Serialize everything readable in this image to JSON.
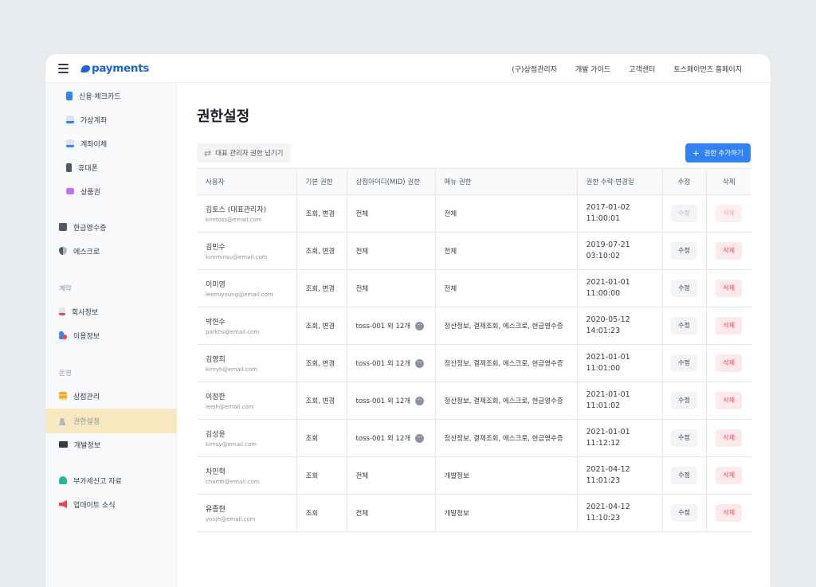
{
  "header": {
    "logo_text": "payments",
    "nav": [
      "(구)상점관리자",
      "개발 가이드",
      "고객센터",
      "토스페이먼츠 홈페이지"
    ]
  },
  "sidebar": {
    "items": [
      {
        "label": "신용·체크카드",
        "icon": "credit-card-icon",
        "color": "#3182f6"
      },
      {
        "label": "가상계좌",
        "icon": "virtual-account-icon",
        "color": "#3182f6"
      },
      {
        "label": "계좌이체",
        "icon": "bank-transfer-icon",
        "color": "#3182f6"
      },
      {
        "label": "휴대폰",
        "icon": "mobile-phone-icon",
        "color": "#4e5968"
      },
      {
        "label": "상품권",
        "icon": "gift-card-icon",
        "color": "#c770f0"
      },
      {
        "label": "현금영수증",
        "icon": "cash-receipt-icon",
        "color": "#4e5968"
      },
      {
        "label": "에스크로",
        "icon": "escrow-shield-icon",
        "color": "#4e5968"
      },
      {
        "label": "회사정보",
        "icon": "company-info-icon",
        "color": "#f04452"
      },
      {
        "label": "이용정보",
        "icon": "usage-info-icon",
        "color": "#3182f6"
      },
      {
        "label": "상점관리",
        "icon": "store-icon",
        "color": "#f5a623"
      },
      {
        "label": "권한설정",
        "icon": "user-add-icon",
        "color": "#b0b8c1"
      },
      {
        "label": "개발정보",
        "icon": "monitor-icon",
        "color": "#333d4b"
      },
      {
        "label": "부가세신고 자료",
        "icon": "tax-document-icon",
        "color": "#1fb99a"
      },
      {
        "label": "업데이트 소식",
        "icon": "megaphone-icon",
        "color": "#f04452"
      }
    ],
    "sections": [
      "계약",
      "운영"
    ],
    "active_index": 10
  },
  "main": {
    "title": "권한설정",
    "transfer_button": "대표 관리자 권한 넘기기",
    "add_button": "권한 추가하기",
    "columns": [
      "사용자",
      "기본 권한",
      "상점아이디(MID) 권한",
      "메뉴 권한",
      "권한 수락·변경일",
      "수정",
      "삭제"
    ],
    "rows": [
      {
        "name": "김토스 (대표관리자)",
        "email": "kimtoss@email.com",
        "basic": "조회, 변경",
        "mid": "전체",
        "mid_more": false,
        "menu": "전체",
        "date": "2017-01-02",
        "time": "11:00:01",
        "edit": "수정",
        "del": "삭제",
        "disabled": true
      },
      {
        "name": "김민수",
        "email": "kimminsu@email.com",
        "basic": "조회, 변경",
        "mid": "전체",
        "mid_more": false,
        "menu": "전체",
        "date": "2019-07-21",
        "time": "03:10:02",
        "edit": "수정",
        "del": "삭제",
        "disabled": false
      },
      {
        "name": "이미영",
        "email": "leemiyoung@email.com",
        "basic": "조회, 변경",
        "mid": "전체",
        "mid_more": false,
        "menu": "전체",
        "date": "2021-01-01",
        "time": "11:00:00",
        "edit": "수정",
        "del": "삭제",
        "disabled": false
      },
      {
        "name": "박현수",
        "email": "parkhs@email.com",
        "basic": "조회, 변경",
        "mid": "toss-001 외 12개",
        "mid_more": true,
        "menu": "정산정보, 결제조회, 에스크로, 현금영수증",
        "date": "2020-05-12",
        "time": "14:01:23",
        "edit": "수정",
        "del": "삭제",
        "disabled": false
      },
      {
        "name": "김영희",
        "email": "kimyh@email.com",
        "basic": "조회, 변경",
        "mid": "toss-001 외 12개",
        "mid_more": true,
        "menu": "정산정보, 결제조회, 에스크로, 현금영수증",
        "date": "2021-01-01",
        "time": "11:01:00",
        "edit": "수정",
        "del": "삭제",
        "disabled": false
      },
      {
        "name": "이정한",
        "email": "leejh@email.com",
        "basic": "조회, 변경",
        "mid": "toss-001 외 12개",
        "mid_more": true,
        "menu": "정산정보, 결제조회, 에스크로, 현금영수증",
        "date": "2021-01-01",
        "time": "11:01:02",
        "edit": "수정",
        "del": "삭제",
        "disabled": false
      },
      {
        "name": "김성윤",
        "email": "kimsy@email.com",
        "basic": "조회",
        "mid": "toss-001 외 12개",
        "mid_more": true,
        "menu": "정산정보, 결제조회, 에스크로, 현금영수증",
        "date": "2021-01-01",
        "time": "11:12:12",
        "edit": "수정",
        "del": "삭제",
        "disabled": false
      },
      {
        "name": "차민혁",
        "email": "chamh@email.com",
        "basic": "조회",
        "mid": "전체",
        "mid_more": false,
        "menu": "개발정보",
        "date": "2021-04-12",
        "time": "11:01:23",
        "edit": "수정",
        "del": "삭제",
        "disabled": false
      },
      {
        "name": "유종현",
        "email": "yoojh@email.com",
        "basic": "조회",
        "mid": "전체",
        "mid_more": false,
        "menu": "개발정보",
        "date": "2021-04-12",
        "time": "11:10:23",
        "edit": "수정",
        "del": "삭제",
        "disabled": false
      }
    ]
  }
}
